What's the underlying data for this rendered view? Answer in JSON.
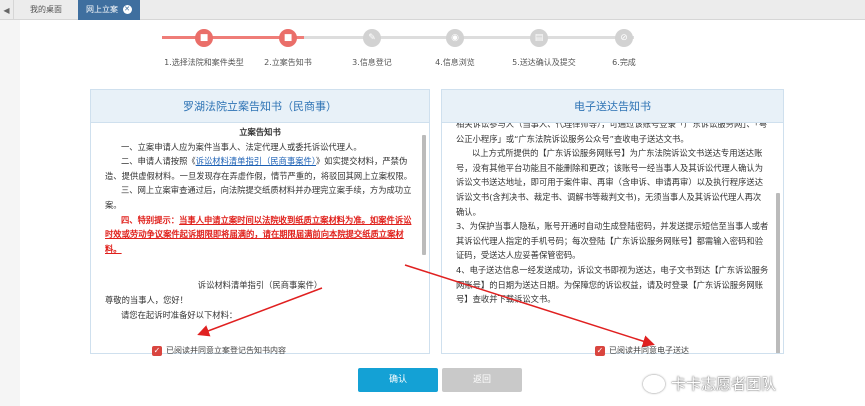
{
  "tabs": {
    "home": "我的桌面",
    "active": "网上立案"
  },
  "stepper": {
    "steps": [
      {
        "label": "1.选择法院和案件类型",
        "icon": "■"
      },
      {
        "label": "2.立案告知书",
        "icon": "■"
      },
      {
        "label": "3.信息登记",
        "icon": "✎"
      },
      {
        "label": "4.信息浏览",
        "icon": "◉"
      },
      {
        "label": "5.送达确认及提交",
        "icon": "▤"
      },
      {
        "label": "6.完成",
        "icon": "⊘"
      }
    ]
  },
  "left_panel": {
    "title": "罗湖法院立案告知书（民商事）",
    "heading": "立案告知书",
    "p1": "一、立案申请人应为案件当事人、法定代理人或委托诉讼代理人。",
    "p2_a": "二、申请人请按照《",
    "p2_link": "诉讼材料清单指引（民商事案件）",
    "p2_b": "》如实提交材料，严禁伪造、提供虚假材料。一旦发现存在弄虚作假，情节严重的，将驳回其网上立案权限。",
    "p3": "三、网上立案审查通过后，向法院提交纸质材料并办理完立案手续，方为成功立案。",
    "p4_label": "四、特别提示：",
    "p4_text": "当事人申请立案时间以法院收到纸质立案材料为准。如案件诉讼时效或劳动争议案件起诉期限即将届满的，请在期限届满前向本院提交纸质立案材料。",
    "subheading": "诉讼材料清单指引（民商事案件）",
    "greeting": "尊敬的当事人，您好！",
    "cutoff": "请您在起诉时准备好以下材料："
  },
  "right_panel": {
    "title": "电子送达告知书",
    "t0": "相关诉讼参与人（当事人、代理律师等），可通过该账号登录「广东诉讼服务网」、「粤公正小程序」或“广东法院诉讼服务公众号”查收电子送达文书。",
    "t1": "以上方式所提供的【广东诉讼服务网账号】为广东法院诉讼文书送达专用送达账号，没有其他平台功能且不能删除和更改；该账号一经当事人及其诉讼代理人确认为诉讼文书送达地址，即可用于案件审、再审（含申诉、申请再审）以及执行程序送达诉讼文书(含判决书、裁定书、调解书等裁判文书)，无须当事人及其诉讼代理人再次确认。",
    "t2": "3、为保护当事人隐私，账号开通时自动生成登陆密码，并发送提示短信至当事人或者其诉讼代理人指定的手机号码；每次登陆【广东诉讼服务网账号】都需输入密码和验证码，受送达人应妥善保管密码。",
    "t3": "4、电子送达信息一经发送成功，诉讼文书即视为送达，电子文书到达【广东诉讼服务网账号】的日期为送达日期。为保障您的诉讼权益，请及时登录【广东诉讼服务网账号】查收并下载诉讼文书。"
  },
  "agreements": {
    "left": "已阅读并同意立案登记告知书内容",
    "right": "已阅读并同意电子送达"
  },
  "buttons": {
    "confirm": "确认",
    "back": "返回"
  },
  "watermark": "卡卡志愿者团队",
  "colors": {
    "accent_red": "#ea6e69",
    "title_blue": "#2f74b5",
    "confirm_blue": "#14a1d5",
    "tab_blue": "#3f6f9f"
  }
}
